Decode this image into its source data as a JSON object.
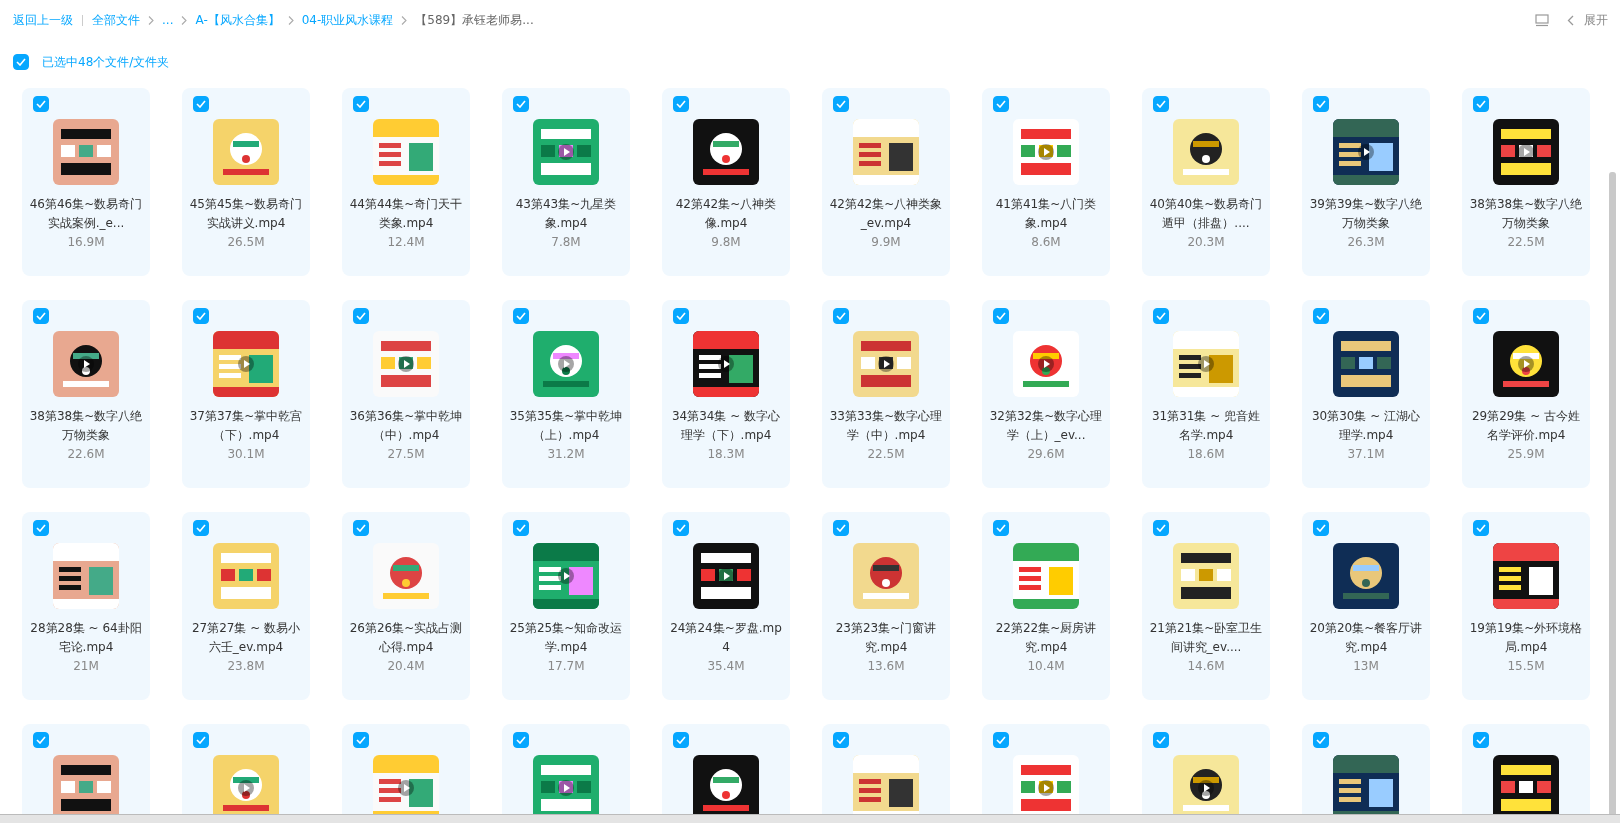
{
  "breadcrumb": {
    "back": "返回上一级",
    "items": [
      {
        "label": "全部文件",
        "current": false
      },
      {
        "label": "...",
        "current": false
      },
      {
        "label": "A-【风水合集】",
        "current": false
      },
      {
        "label": "04-职业风水课程",
        "current": false
      },
      {
        "label": "【589】承钰老师易...",
        "current": true
      }
    ]
  },
  "toolbar": {
    "expand": "展开"
  },
  "selection": {
    "checked": true,
    "label": "已选中48个文件/文件夹"
  },
  "files": [
    {
      "name": "46第46集~数易奇门实战案例._e...",
      "size": "16.9M",
      "checked": true,
      "play": false
    },
    {
      "name": "45第45集~数易奇门实战讲义.mp4",
      "size": "26.5M",
      "checked": true,
      "play": false
    },
    {
      "name": "44第44集~奇门天干类象.mp4",
      "size": "12.4M",
      "checked": true,
      "play": false
    },
    {
      "name": "43第43集~九星类象.mp4",
      "size": "7.8M",
      "checked": true,
      "play": true
    },
    {
      "name": "42第42集~八神类像.mp4",
      "size": "9.8M",
      "checked": true,
      "play": false
    },
    {
      "name": "42第42集~八神类象_ev.mp4",
      "size": "9.9M",
      "checked": true,
      "play": false
    },
    {
      "name": "41第41集~八门类象.mp4",
      "size": "8.6M",
      "checked": true,
      "play": true
    },
    {
      "name": "40第40集~数易奇门遁甲（排盘）....",
      "size": "20.3M",
      "checked": true,
      "play": false
    },
    {
      "name": "39第39集~数字八绝万物类象",
      "size": "26.3M",
      "checked": true,
      "play": true
    },
    {
      "name": "38第38集~数字八绝万物类象",
      "size": "22.5M",
      "checked": true,
      "play": true
    },
    {
      "name": "38第38集~数字八绝万物类象",
      "size": "22.6M",
      "checked": true,
      "play": true
    },
    {
      "name": "37第37集~掌中乾宫（下）.mp4",
      "size": "30.1M",
      "checked": true,
      "play": true
    },
    {
      "name": "36第36集~掌中乾坤（中）.mp4",
      "size": "27.5M",
      "checked": true,
      "play": true
    },
    {
      "name": "35第35集~掌中乾坤（上）.mp4",
      "size": "31.2M",
      "checked": true,
      "play": true
    },
    {
      "name": "34第34集 ~ 数字心理学（下）.mp4",
      "size": "18.3M",
      "checked": true,
      "play": true
    },
    {
      "name": "33第33集~数字心理学（中）.mp4",
      "size": "22.5M",
      "checked": true,
      "play": true
    },
    {
      "name": "32第32集~数字心理学（上）_ev...",
      "size": "29.6M",
      "checked": true,
      "play": true
    },
    {
      "name": "31第31集 ~ 兜音姓名学.mp4",
      "size": "18.6M",
      "checked": true,
      "play": true
    },
    {
      "name": "30第30集 ~ 江湖心理学.mp4",
      "size": "37.1M",
      "checked": true,
      "play": false
    },
    {
      "name": "29第29集 ~ 古今姓名学评价.mp4",
      "size": "25.9M",
      "checked": true,
      "play": true
    },
    {
      "name": "28第28集 ~ 64卦阳宅论.mp4",
      "size": "21M",
      "checked": true,
      "play": false
    },
    {
      "name": "27第27集 ~ 数易小六壬_ev.mp4",
      "size": "23.8M",
      "checked": true,
      "play": false
    },
    {
      "name": "26第26集~实战占测心得.mp4",
      "size": "20.4M",
      "checked": true,
      "play": false
    },
    {
      "name": "25第25集~知命改运学.mp4",
      "size": "17.7M",
      "checked": true,
      "play": true
    },
    {
      "name": "24第24集~罗盘.mp4",
      "size": "35.4M",
      "checked": true,
      "play": true
    },
    {
      "name": "23第23集~门窗讲究.mp4",
      "size": "13.6M",
      "checked": true,
      "play": false
    },
    {
      "name": "22第22集~厨房讲究.mp4",
      "size": "10.4M",
      "checked": true,
      "play": false
    },
    {
      "name": "21第21集~卧室卫生间讲究_ev....",
      "size": "14.6M",
      "checked": true,
      "play": false
    },
    {
      "name": "20第20集~餐客厅讲究.mp4",
      "size": "13M",
      "checked": true,
      "play": false
    },
    {
      "name": "19第19集~外环境格局.mp4",
      "size": "15.5M",
      "checked": true,
      "play": false
    },
    {
      "checked": true,
      "play": false
    },
    {
      "checked": true,
      "play": true
    },
    {
      "checked": true,
      "play": true
    },
    {
      "checked": true,
      "play": true
    },
    {
      "checked": true,
      "play": false
    },
    {
      "checked": true,
      "play": false
    },
    {
      "checked": true,
      "play": true
    },
    {
      "checked": true,
      "play": true
    },
    {
      "checked": true,
      "play": false
    },
    {
      "checked": true,
      "play": false
    }
  ]
}
